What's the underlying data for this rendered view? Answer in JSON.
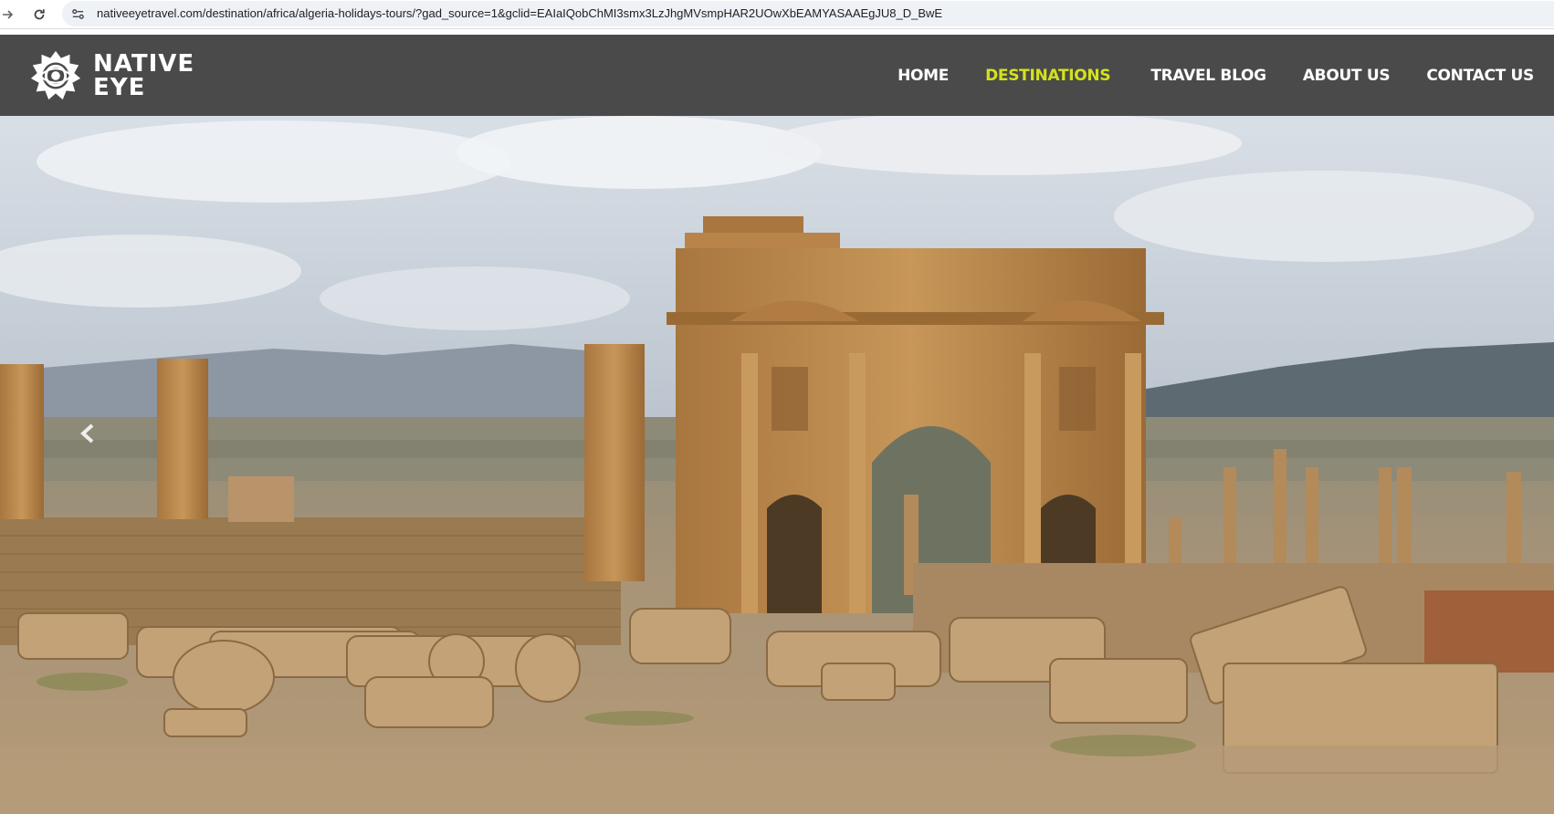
{
  "browser": {
    "url": "nativeeyetravel.com/destination/africa/algeria-holidays-tours/?gad_source=1&gclid=EAIaIQobChMI3smx3LzJhgMVsmpHAR2UOwXbEAMYASAAEgJU8_D_BwE",
    "icons": [
      "forward-icon",
      "reload-icon",
      "site-info-icon"
    ]
  },
  "site": {
    "logo_line1": "NATIVE",
    "logo_line2": "EYE",
    "nav": [
      {
        "label": "HOME",
        "active": false
      },
      {
        "label": "DESTINATIONS",
        "active": true
      },
      {
        "label": "TRAVEL BLOG",
        "active": false
      },
      {
        "label": "ABOUT US",
        "active": false
      },
      {
        "label": "CONTACT US",
        "active": false
      }
    ],
    "colors": {
      "header_bg": "#4a4a4a",
      "nav_text": "#ffffff",
      "nav_active": "#d4e11c"
    }
  },
  "hero": {
    "image_subject": "Roman ruins of Timgad, Algeria - Arch of Trajan",
    "prev_icon": "chevron-left-icon"
  }
}
